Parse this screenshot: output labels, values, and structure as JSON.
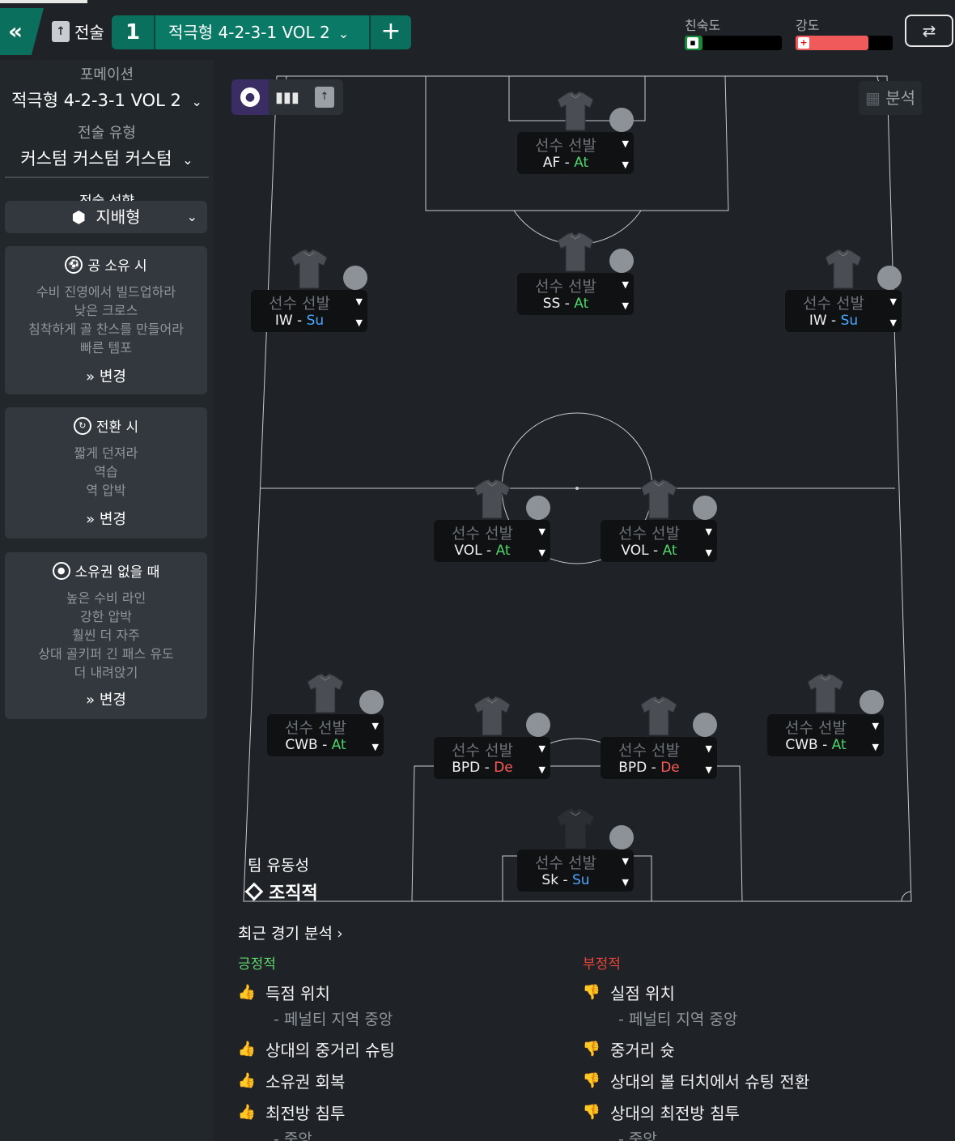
{
  "topbar": {
    "back_label": "«",
    "tactics_label": "전술",
    "slot_number": "1",
    "slot_name": "적극형 4-2-3-1 VOL 2",
    "add_label": "+",
    "familiarity_label": "친숙도",
    "intensity_label": "강도",
    "familiarity_level": 0.18,
    "intensity_level": 0.75,
    "swap_label": "⇄"
  },
  "sidebar": {
    "formation_heading": "포메이션",
    "formation_value": "적극형 4-2-3-1 VOL 2",
    "type_heading": "전술 유형",
    "type_value": "커스텀 커스텀 커스텀",
    "mentality_heading": "전술 성향",
    "mentality_value": "지배형",
    "in_possession": {
      "title": "공 소유 시",
      "lines": [
        "수비 진영에서 빌드업하라",
        "낮은 크로스",
        "침착하게 골 찬스를 만들어라",
        "빠른 템포"
      ],
      "change": "변경"
    },
    "in_transition": {
      "title": "전환 시",
      "lines": [
        "짧게 던져라",
        "역습",
        "역 압박"
      ],
      "change": "변경"
    },
    "out_of_possession": {
      "title": "소유권 없을 때",
      "lines": [
        "높은 수비 라인",
        "강한 압박",
        "훨씬 더 자주",
        "상대 골키퍼 긴 패스 유도",
        "더 내려앉기"
      ],
      "change": "변경"
    }
  },
  "pitch": {
    "analysis_label": "분석",
    "mobility_label": "팀 유동성",
    "mobility_value": "조직적",
    "players": [
      {
        "name": "선수 선발",
        "role": "AF",
        "duty": "At",
        "pos": "st"
      },
      {
        "name": "선수 선발",
        "role": "SS",
        "duty": "At",
        "pos": "am"
      },
      {
        "name": "선수 선발",
        "role": "IW",
        "duty": "Su",
        "pos": "aml"
      },
      {
        "name": "선수 선발",
        "role": "IW",
        "duty": "Su",
        "pos": "amr"
      },
      {
        "name": "선수 선발",
        "role": "VOL",
        "duty": "At",
        "pos": "dml"
      },
      {
        "name": "선수 선발",
        "role": "VOL",
        "duty": "At",
        "pos": "dmr"
      },
      {
        "name": "선수 선발",
        "role": "CWB",
        "duty": "At",
        "pos": "wbl"
      },
      {
        "name": "선수 선발",
        "role": "BPD",
        "duty": "De",
        "pos": "dcl"
      },
      {
        "name": "선수 선발",
        "role": "BPD",
        "duty": "De",
        "pos": "dcr"
      },
      {
        "name": "선수 선발",
        "role": "CWB",
        "duty": "At",
        "pos": "wbr"
      },
      {
        "name": "선수 선발",
        "role": "Sk",
        "duty": "Su",
        "pos": "gk"
      }
    ]
  },
  "recent": {
    "title": "최근 경기 분석",
    "positive_label": "긍정적",
    "negative_label": "부정적",
    "positive": [
      {
        "text": "득점 위치",
        "sub": "- 페널티 지역 중앙",
        "color": "#1fa83a"
      },
      {
        "text": "상대의 중거리 슈팅",
        "sub": "",
        "color": "#1fa83a"
      },
      {
        "text": "소유권 회복",
        "sub": "",
        "color": "#7cc43a"
      },
      {
        "text": "최전방 침투",
        "sub": "- 중앙",
        "color": "#7cc43a"
      }
    ],
    "negative": [
      {
        "text": "실점 위치",
        "sub": "- 페널티 지역 중앙",
        "color": "#d11f1f"
      },
      {
        "text": "중거리 슛",
        "sub": "",
        "color": "#e23a2a"
      },
      {
        "text": "상대의 볼 터치에서 슈팅 전환",
        "sub": "",
        "color": "#f07a1e"
      },
      {
        "text": "상대의 최전방 침투",
        "sub": "- 중앙",
        "color": "#f07a1e"
      }
    ]
  },
  "colors": {
    "accent": "#0b6f5e",
    "positive": "#5fd46a",
    "negative": "#e8443a",
    "familiarity": "#1a8a3a",
    "intensity": "#f05a5a"
  }
}
